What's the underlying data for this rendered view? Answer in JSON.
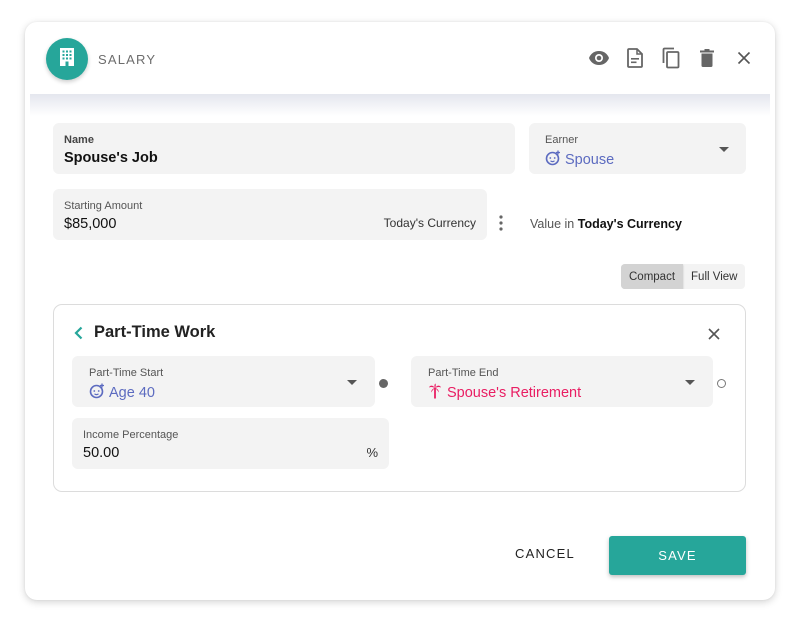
{
  "header": {
    "title": "SALARY",
    "icons": [
      "building-icon",
      "eye-icon",
      "document-icon",
      "copy-icon",
      "delete-icon",
      "close-icon"
    ],
    "accent": "#26a69a"
  },
  "form": {
    "name": {
      "label": "Name",
      "value": "Spouse's Job"
    },
    "earner": {
      "label": "Earner",
      "value": "Spouse",
      "icon": "child-face-icon",
      "color": "#5c6bc0"
    },
    "starting_amount": {
      "label": "Starting Amount",
      "value": "$85,000",
      "suffix": "Today's Currency"
    },
    "value_in": {
      "prefix": "Value in",
      "strong": "Today's Currency"
    }
  },
  "view_toggle": {
    "options": [
      "Compact",
      "Full View"
    ],
    "selected": "Compact"
  },
  "part_time": {
    "title": "Part-Time Work",
    "start": {
      "label": "Part-Time Start",
      "value": "Age 40",
      "icon": "child-face-icon",
      "color": "#5c6bc0"
    },
    "end": {
      "label": "Part-Time End",
      "value": "Spouse's Retirement",
      "icon": "palm-tree-icon",
      "color": "#e91e63"
    },
    "income_percentage": {
      "label": "Income Percentage",
      "value": "50.00",
      "suffix": "%"
    }
  },
  "actions": {
    "cancel": "CANCEL",
    "save": "SAVE"
  }
}
